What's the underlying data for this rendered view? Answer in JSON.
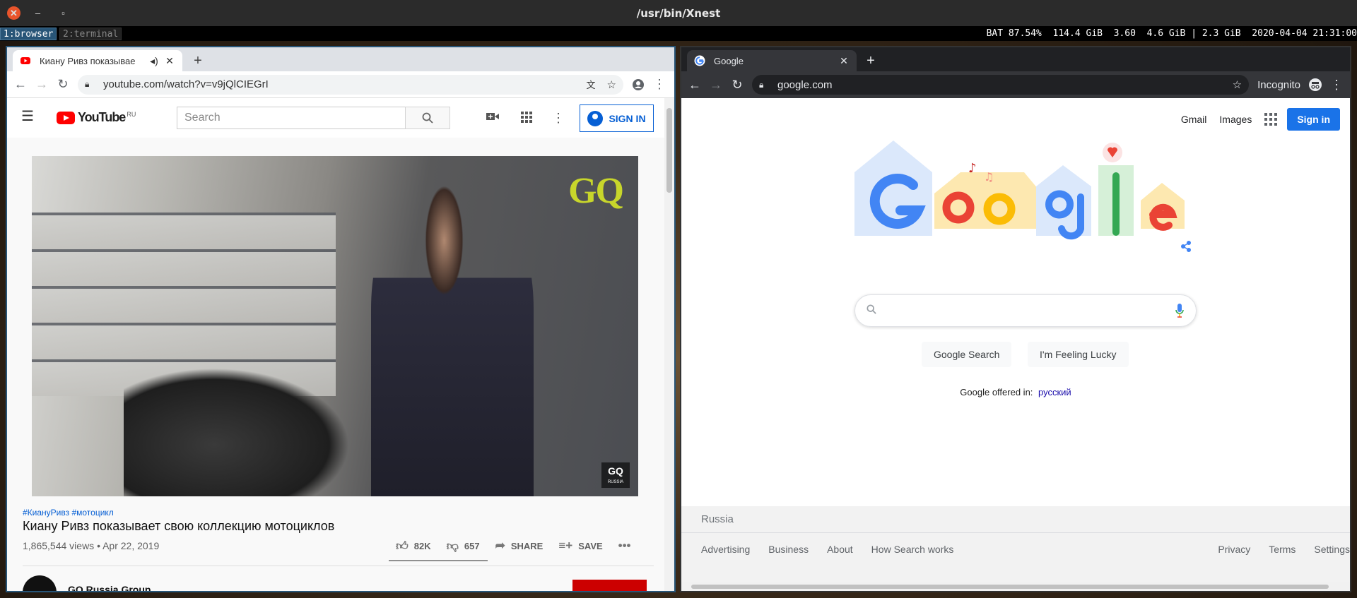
{
  "xnest": {
    "title": "/usr/bin/Xnest"
  },
  "i3bar": {
    "workspaces": [
      "1:browser",
      "2:terminal"
    ],
    "status": "BAT 87.54%  114.4 GiB  3.60  4.6 GiB | 2.3 GiB  2020-04-04 21:31:00"
  },
  "left_browser": {
    "tab_title": "Киану Ривз показывае",
    "url": "youtube.com/watch?v=v9jQlCIEGrI",
    "youtube": {
      "logo_text": "YouTube",
      "country": "RU",
      "search_placeholder": "Search",
      "sign_in": "SIGN IN",
      "gq_logo": "GQ",
      "gq_watermark": "GQ",
      "gq_watermark_sub": "RUSSIA",
      "hashtags": "#КиануРивз #мотоцикл",
      "video_title": "Киану Ривз показывает свою коллекцию мотоциклов",
      "views_date": "1,865,544 views • Apr 22, 2019",
      "likes": "82K",
      "dislikes": "657",
      "share": "SHARE",
      "save": "SAVE",
      "channel_name": "GQ Russia Group"
    }
  },
  "right_browser": {
    "tab_title": "Google",
    "url": "google.com",
    "incognito_label": "Incognito",
    "google": {
      "nav": [
        "Gmail",
        "Images"
      ],
      "sign_in": "Sign in",
      "search_button": "Google Search",
      "lucky_button": "I'm Feeling Lucky",
      "offered_in": "Google offered in:",
      "offered_lang": "русский",
      "country": "Russia",
      "footer_left": [
        "Advertising",
        "Business",
        "About",
        "How Search works"
      ],
      "footer_right": [
        "Privacy",
        "Terms",
        "Settings"
      ]
    }
  },
  "colors": {
    "youtube_red": "#ff0000",
    "google_blue": "#4285f4",
    "google_red": "#ea4335",
    "google_yellow": "#fbbc05",
    "google_green": "#34a853",
    "i3_focus": "#285577"
  }
}
